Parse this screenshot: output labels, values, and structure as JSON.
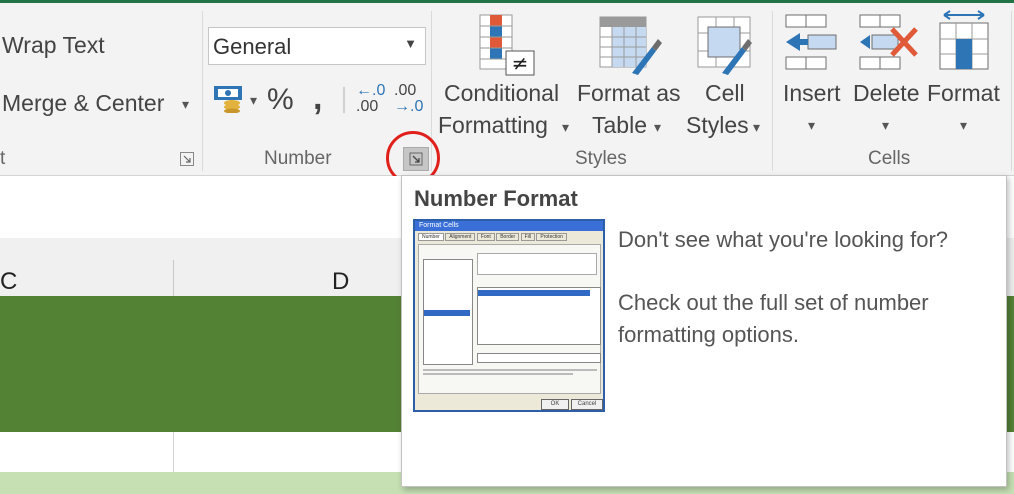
{
  "ribbon": {
    "alignment": {
      "wrap_text": "Wrap Text",
      "merge_center": "Merge & Center",
      "group_label_partial": "t"
    },
    "number": {
      "format_value": "General",
      "currency_symbol": "▾",
      "percent": "%",
      "comma": ",",
      "increase_decimal_top": "←.0",
      "increase_decimal_bottom": ".00",
      "decrease_decimal_top": ".00",
      "decrease_decimal_bottom": "→.0",
      "group_label": "Number"
    },
    "styles": {
      "conditional_line1": "Conditional",
      "conditional_line2": "Formatting",
      "format_table_line1": "Format as",
      "format_table_line2": "Table",
      "cell_styles_line1": "Cell",
      "cell_styles_line2": "Styles",
      "group_label": "Styles"
    },
    "cells": {
      "insert": "Insert",
      "delete": "Delete",
      "format": "Format",
      "group_label": "Cells"
    },
    "caret": "▾"
  },
  "sheet": {
    "columns": [
      "C",
      "D"
    ]
  },
  "tooltip": {
    "title": "Number Format",
    "line1": "Don't see what you're looking for?",
    "line2": "Check out the full set of number",
    "line3": "formatting options.",
    "preview_title": "Format Cells",
    "preview_tabs": [
      "Number",
      "Alignment",
      "Font",
      "Border",
      "Fill",
      "Protection"
    ],
    "preview_ok": "OK",
    "preview_cancel": "Cancel"
  },
  "colors": {
    "accent_green": "#217346",
    "row_green": "#548235",
    "row_light_green": "#c6e0b4",
    "highlight_red": "#e0201b"
  }
}
